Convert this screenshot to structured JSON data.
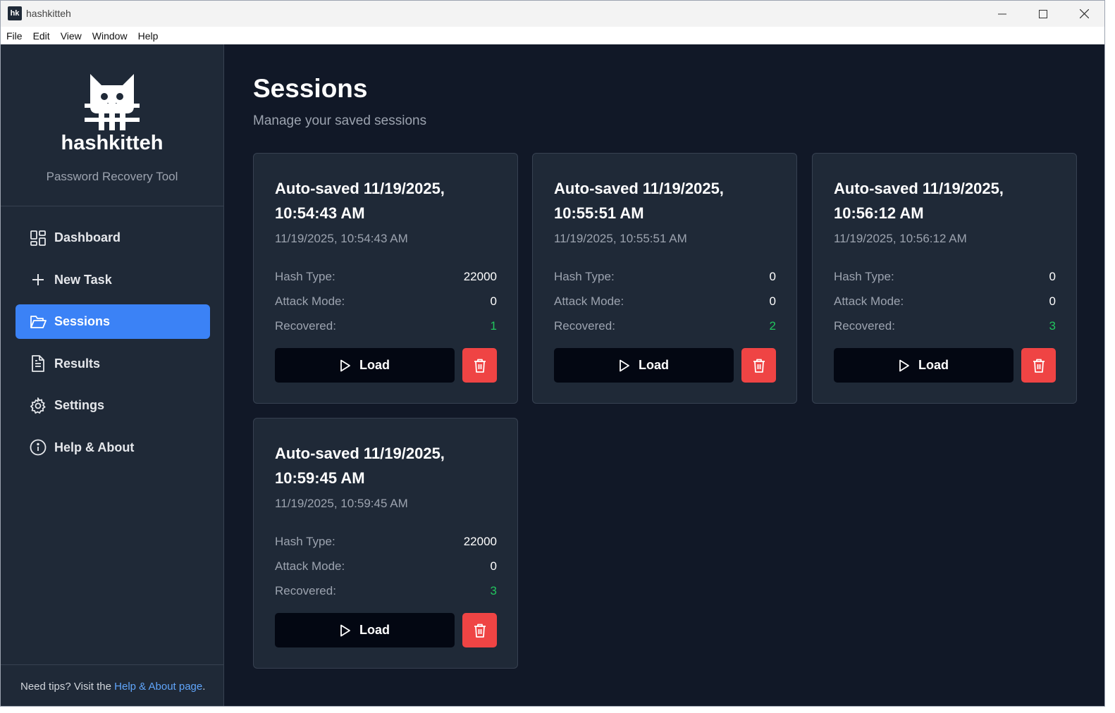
{
  "window": {
    "title": "hashkitteh",
    "app_icon_text": "hk"
  },
  "menu": [
    "File",
    "Edit",
    "View",
    "Window",
    "Help"
  ],
  "sidebar": {
    "brand_name": "hashkitteh",
    "brand_subtitle": "Password Recovery Tool",
    "items": [
      {
        "label": "Dashboard",
        "icon": "dashboard-icon",
        "active": false
      },
      {
        "label": "New Task",
        "icon": "plus-icon",
        "active": false
      },
      {
        "label": "Sessions",
        "icon": "folder-open-icon",
        "active": true
      },
      {
        "label": "Results",
        "icon": "document-icon",
        "active": false
      },
      {
        "label": "Settings",
        "icon": "gear-icon",
        "active": false
      },
      {
        "label": "Help & About",
        "icon": "info-icon",
        "active": false
      }
    ],
    "footer": {
      "prefix": "Need tips? Visit the ",
      "link": "Help & About page",
      "suffix": "."
    }
  },
  "page": {
    "title": "Sessions",
    "subtitle": "Manage your saved sessions"
  },
  "labels": {
    "hash_type": "Hash Type:",
    "attack_mode": "Attack Mode:",
    "recovered": "Recovered:",
    "load": "Load"
  },
  "sessions": [
    {
      "title": "Auto-saved 11/19/2025, 10:54:43 AM",
      "date": "11/19/2025, 10:54:43 AM",
      "hash_type": "22000",
      "attack_mode": "0",
      "recovered": "1"
    },
    {
      "title": "Auto-saved 11/19/2025, 10:55:51 AM",
      "date": "11/19/2025, 10:55:51 AM",
      "hash_type": "0",
      "attack_mode": "0",
      "recovered": "2"
    },
    {
      "title": "Auto-saved 11/19/2025, 10:56:12 AM",
      "date": "11/19/2025, 10:56:12 AM",
      "hash_type": "0",
      "attack_mode": "0",
      "recovered": "3"
    },
    {
      "title": "Auto-saved 11/19/2025, 10:59:45 AM",
      "date": "11/19/2025, 10:59:45 AM",
      "hash_type": "22000",
      "attack_mode": "0",
      "recovered": "3"
    }
  ],
  "colors": {
    "accent": "#3b82f6",
    "danger": "#ef4444",
    "success": "#22c55e",
    "bg": "#111827",
    "panel": "#1f2937"
  }
}
